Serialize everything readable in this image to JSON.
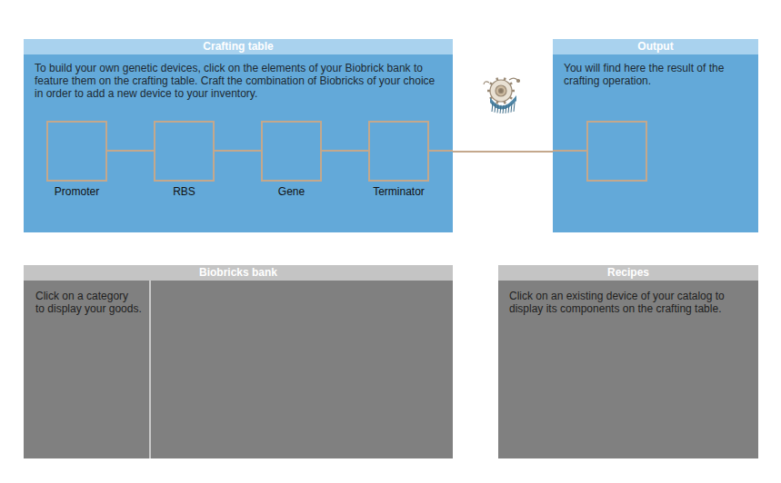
{
  "crafting_table": {
    "title": "Crafting table",
    "description": "To build your own genetic devices, click on the elements of your Biobrick bank to feature them on the crafting table. Craft the combination of Biobricks of your choice in order to add a new device to your inventory.",
    "slots": [
      {
        "label": "Promoter"
      },
      {
        "label": "RBS"
      },
      {
        "label": "Gene"
      },
      {
        "label": "Terminator"
      }
    ]
  },
  "output": {
    "title": "Output",
    "description": "You will find here the result of the crafting operation."
  },
  "biobricks_bank": {
    "title": "Biobricks bank",
    "hint": "Click on a category\nto display your goods."
  },
  "recipes": {
    "title": "Recipes",
    "hint": "Click on an existing device of your catalog to display its components on the crafting table."
  }
}
